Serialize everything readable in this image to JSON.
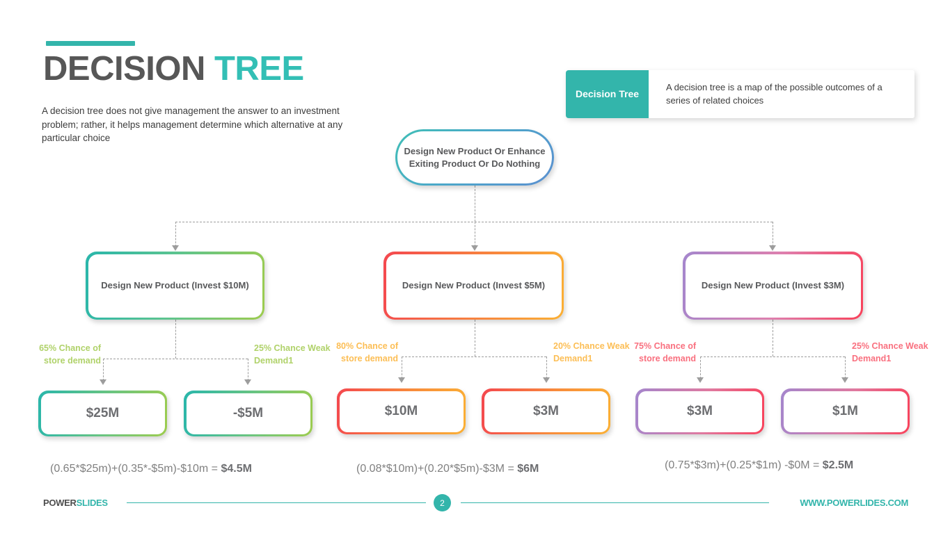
{
  "header": {
    "title_main": "DECISION",
    "title_accent": "TREE",
    "intro": "A decision tree does not give management the answer to an investment problem; rather, it helps management determine which alternative at any particular choice",
    "accent_color": "#33b5ab"
  },
  "callout": {
    "tab_label": "Decision Tree",
    "body_text": "A decision tree is a map of the possible outcomes of a series of related choices",
    "tab_color": "#33b5ab"
  },
  "tree": {
    "root": {
      "label": "Design New Product Or Enhance Exiting Product Or Do Nothing",
      "gradient_from": "#3fbfb6",
      "gradient_to": "#5b8fd0"
    },
    "branches": [
      {
        "decision_label": "Design New Product (Invest $10M)",
        "gradient_from": "#29b6ab",
        "gradient_to": "#9dcc4e",
        "label_color": "#b0d26a",
        "left_chance": "65% Chance of store demand",
        "right_chance": "25% Chance Weak Demand1",
        "left_outcome": "$25M",
        "right_outcome": "-$5M",
        "formula_expr": "(0.65*$25m)+(0.35*-$5m)-$10m =",
        "formula_result": "$4.5M"
      },
      {
        "decision_label": "Design New Product (Invest $5M)",
        "gradient_from": "#f4474f",
        "gradient_to": "#fbb034",
        "label_color": "#fcbe55",
        "left_chance": "80% Chance of store demand",
        "right_chance": "20% Chance Weak Demand1",
        "left_outcome": "$10M",
        "right_outcome": "$3M",
        "formula_expr": "(0.08*$10m)+(0.20*$5m)-$3M =",
        "formula_result": "$6M"
      },
      {
        "decision_label": "Design New Product (Invest $3M)",
        "gradient_from": "#a486cd",
        "gradient_to": "#f9415a",
        "label_color": "#f9707f",
        "left_chance": "75% Chance of store demand",
        "right_chance": "25% Chance Weak Demand1",
        "left_outcome": "$3M",
        "right_outcome": "$1M",
        "formula_expr": "(0.75*$3m)+(0.25*$1m) -$0M =",
        "formula_result": "$2.5M"
      }
    ]
  },
  "footer": {
    "logo_dark": "POWER",
    "logo_teal": "SLIDES",
    "page_number": "2",
    "url": "WWW.POWERLIDES.COM",
    "line_color": "#33b5ab"
  }
}
